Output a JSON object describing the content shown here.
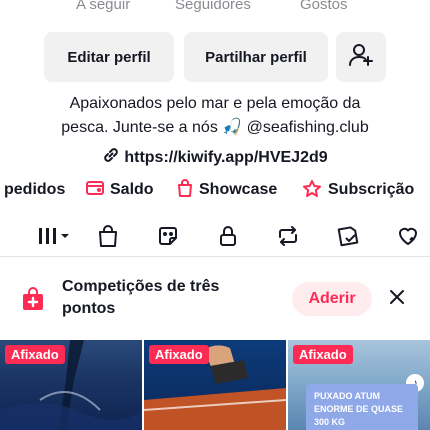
{
  "profile": {
    "stats_labels": [
      "A seguir",
      "Seguidores",
      "Gostos"
    ],
    "buttons": {
      "edit": "Editar perfil",
      "share": "Partilhar perfil"
    },
    "bio_line1": "Apaixonados pelo mar e pela emoção da",
    "bio_line2": "pesca. Junte-se a nós 🎣 @seafishing.club",
    "link": "https://kiwify.app/HVEJ2d9"
  },
  "shortcuts": [
    {
      "label": "pedidos",
      "icon": "orders-icon"
    },
    {
      "label": "Saldo",
      "icon": "wallet-icon"
    },
    {
      "label": "Showcase",
      "icon": "shopping-bag-icon"
    },
    {
      "label": "Subscrição",
      "icon": "subscription-icon"
    }
  ],
  "tabs": [
    {
      "name": "videos-grid",
      "icon": "grid-icon",
      "selected": true
    },
    {
      "name": "shop",
      "icon": "shopping-bag-icon"
    },
    {
      "name": "stickers",
      "icon": "sticker-icon"
    },
    {
      "name": "private",
      "icon": "lock-icon"
    },
    {
      "name": "reposts",
      "icon": "repost-icon"
    },
    {
      "name": "saved",
      "icon": "bookmark-icon"
    },
    {
      "name": "liked",
      "icon": "heart-icon"
    }
  ],
  "banner": {
    "title": "Competições de três pontos",
    "join_label": "Aderir"
  },
  "videos": [
    {
      "pinned_label": "Afixado"
    },
    {
      "pinned_label": "Afixado"
    },
    {
      "pinned_label": "Afixado",
      "caption": "PUXADO ATUM ENORME DE QUASE 300 KG"
    }
  ],
  "colors": {
    "accent": "#fe2c55",
    "text": "#161823",
    "muted": "#8a8b91",
    "button_bg": "#f1f1f2",
    "join_bg": "#ffecef"
  }
}
